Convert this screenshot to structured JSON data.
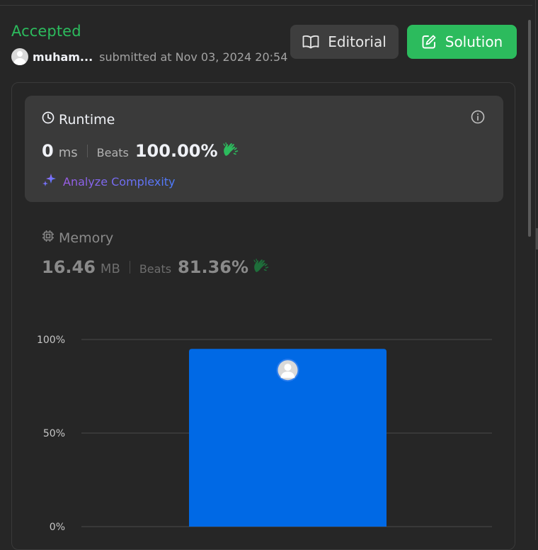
{
  "submission": {
    "status": "Accepted",
    "username": "muham...",
    "submitted_text": "submitted at Nov 03, 2024 20:54"
  },
  "buttons": {
    "editorial": "Editorial",
    "solution": "Solution"
  },
  "runtime": {
    "title": "Runtime",
    "value": "0",
    "unit": "ms",
    "beats_label": "Beats",
    "beats_value": "100.00%",
    "analyze_label": "Analyze Complexity"
  },
  "memory": {
    "title": "Memory",
    "value": "16.46",
    "unit": "MB",
    "beats_label": "Beats",
    "beats_value": "81.36%"
  },
  "colors": {
    "accepted": "#2cbb5d",
    "bar": "#0069e5",
    "grid": "#4a4a4a",
    "tick": "#c7c7c7"
  },
  "chart_data": {
    "type": "bar",
    "categories": [
      ""
    ],
    "values": [
      95
    ],
    "ylim": [
      0,
      100
    ],
    "yticks": [
      {
        "value": 100,
        "label": "100%"
      },
      {
        "value": 50,
        "label": "50%"
      },
      {
        "value": 0,
        "label": "0%"
      }
    ],
    "marker_icon": "user-avatar-icon",
    "grid": true
  }
}
